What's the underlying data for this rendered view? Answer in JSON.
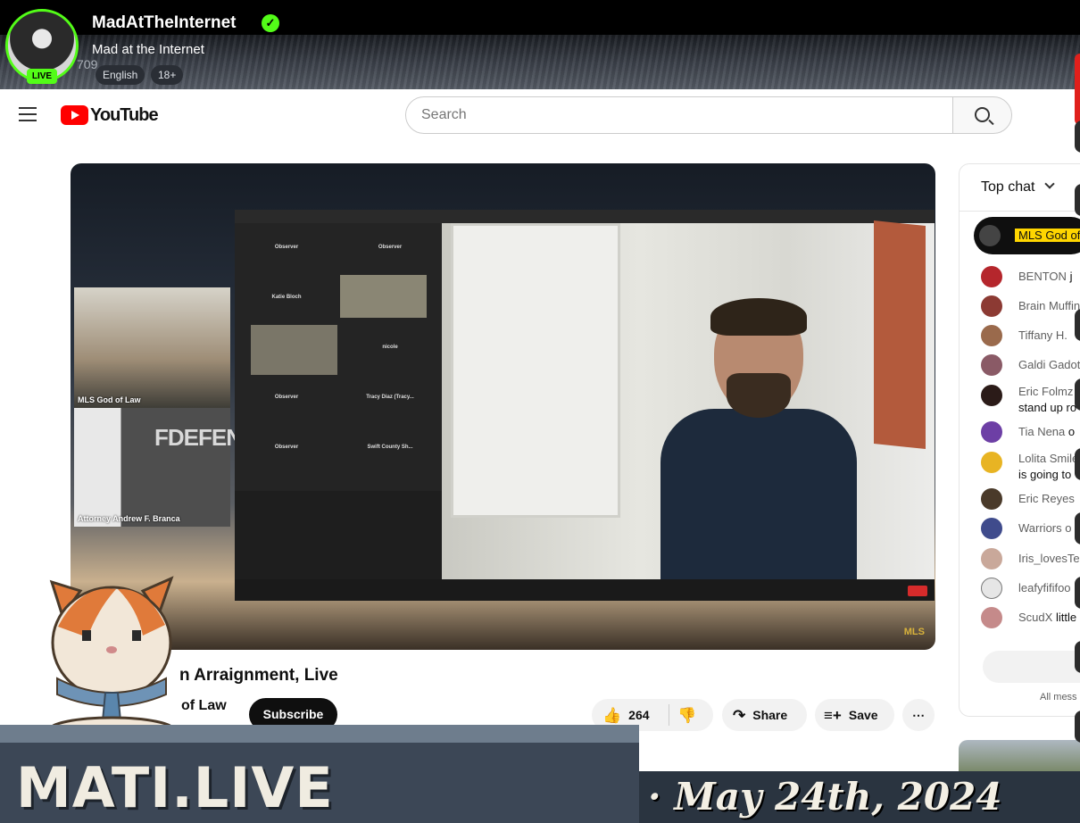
{
  "stream": {
    "channel_name": "MadAtTheInternet",
    "title": "Mad at the Internet",
    "live_badge": "LIVE",
    "viewer_count": "709",
    "tags": [
      "English",
      "18+"
    ]
  },
  "youtube": {
    "logo_text": "YouTube",
    "search_placeholder": "Search",
    "video": {
      "title_visible": "n Arraignment, Live",
      "channel_visible": "of Law",
      "subscribe_label": "Subscribe",
      "like_count": "264",
      "share_label": "Share",
      "save_label": "Save",
      "more_label": "⋯",
      "feed_labels": [
        "MLS God of Law",
        "Attorney Andrew F. Branca"
      ],
      "backdrop_text": "FDEFENSI",
      "watermark": "MLS",
      "participant_tiles": [
        "Observer",
        "Observer",
        "Katie Bloch",
        "",
        "",
        "nicole",
        "Observer",
        "Tracy Diaz (Tracy...",
        "Observer",
        "Swift County Sh..."
      ]
    },
    "chat": {
      "header": "Top chat",
      "pinned_label": "MLS God of",
      "messages": [
        {
          "user": "BENTON",
          "text": "j"
        },
        {
          "user": "Brain Muffin",
          "text": ""
        },
        {
          "user": "Tiffany H.",
          "text": ""
        },
        {
          "user": "Galdi Gadot",
          "text": ""
        },
        {
          "user": "Eric Folmz",
          "text": "stand up ro"
        },
        {
          "user": "Tia Nena",
          "text": "o"
        },
        {
          "user": "Lolita Smile",
          "text": "is going to"
        },
        {
          "user": "Eric Reyes",
          "text": ""
        },
        {
          "user": "Warriors o",
          "text": ""
        },
        {
          "user": "Iris_lovesTe",
          "text": ""
        },
        {
          "user": "leafyfififoo",
          "text": ""
        },
        {
          "user": "ScudX",
          "text": "little"
        }
      ],
      "footer": "All mess"
    }
  },
  "overlay": {
    "banner_text": "MATI.LIVE",
    "date_text": "· May 24th, 2024"
  },
  "colors": {
    "kick_green": "#53fc18",
    "youtube_red": "#ff0000",
    "pinned_yellow": "#ffd600"
  }
}
